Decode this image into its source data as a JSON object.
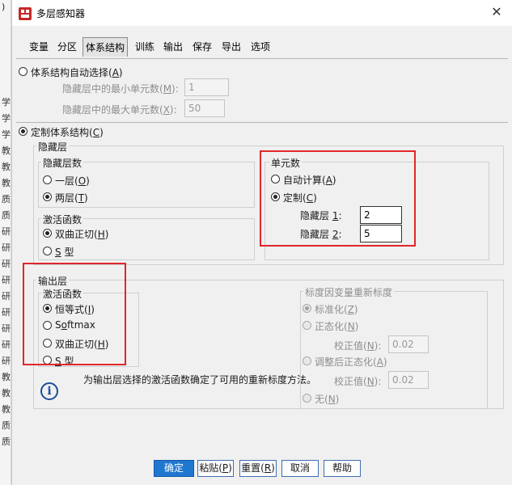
{
  "window": {
    "title": "多层感知器",
    "close_symbol": "✕"
  },
  "background_column": {
    "chars": [
      "学",
      "学",
      "学",
      "教",
      "教",
      "教",
      "质",
      "质",
      "研",
      "研",
      "研",
      "研",
      "研",
      "研",
      "研",
      "研",
      "研",
      "教",
      "教",
      "教",
      "质",
      "质"
    ]
  },
  "tabs": [
    "变量",
    "分区",
    "体系结构",
    "训练",
    "输出",
    "保存",
    "导出",
    "选项"
  ],
  "active_tab": "体系结构",
  "architecture": {
    "auto": {
      "label_pre": "体系结构自动选择(",
      "label_key": "A",
      "label_post": ")",
      "min_units": {
        "label_pre": "隐藏层中的最小单元数(",
        "label_key": "M",
        "label_post": "):",
        "value": "1"
      },
      "max_units": {
        "label_pre": "隐藏层中的最大单元数(",
        "label_key": "X",
        "label_post": "):",
        "value": "50"
      }
    },
    "custom": {
      "label_pre": "定制体系结构(",
      "label_key": "C",
      "label_post": ")"
    }
  },
  "hidden_layer": {
    "title": "隐藏层",
    "layer_count": {
      "title": "隐藏层数",
      "opt1": {
        "pre": "一层(",
        "key": "O",
        "post": ")"
      },
      "opt2": {
        "pre": "两层(",
        "key": "T",
        "post": ")"
      }
    },
    "activation": {
      "title": "激活函数",
      "opt1": {
        "pre": "双曲正切(",
        "key": "H",
        "post": ")"
      },
      "opt2": {
        "key": "S",
        "post": " 型"
      }
    },
    "units": {
      "title": "单元数",
      "auto": {
        "pre": "自动计算(",
        "key": "A",
        "post": ")"
      },
      "custom": {
        "pre": "定制(",
        "key": "C",
        "post": ")"
      },
      "layer1": {
        "pre": "隐藏层 ",
        "key": "1",
        "post": ":",
        "value": "2"
      },
      "layer2": {
        "pre": "隐藏层 ",
        "key": "2",
        "post": ":",
        "value": "5"
      }
    }
  },
  "output_layer": {
    "title": "输出层",
    "activation": {
      "title": "激活函数",
      "opt1": {
        "pre": "恒等式(",
        "key": "I",
        "post": ")"
      },
      "opt2": {
        "pre": "S",
        "key": "o",
        "post": "ftmax"
      },
      "opt3": {
        "pre": "双曲正切(",
        "key": "H",
        "post": ")"
      },
      "opt4": {
        "key": "S",
        "post": " 型"
      }
    },
    "rescale": {
      "title": "标度因变量重新标度",
      "std": {
        "pre": "标准化(",
        "key": "Z",
        "post": ")"
      },
      "norm": {
        "pre": "正态化(",
        "key": "N",
        "post": ")"
      },
      "corr1": {
        "pre": "校正值(",
        "key": "N",
        "post": "):",
        "value": "0.02"
      },
      "adj": {
        "pre": "调整后正态化(",
        "key": "A",
        "post": ")"
      },
      "corr2": {
        "pre": "校正值(",
        "key": "N",
        "post": "):",
        "value": "0.02"
      },
      "none": {
        "pre": "无(",
        "key": "N",
        "post": ")"
      }
    },
    "info_text": "为输出层选择的激活函数确定了可用的重新标度方法。"
  },
  "buttons": {
    "ok": "确定",
    "paste": {
      "pre": "粘贴(",
      "key": "P",
      "post": ")"
    },
    "reset": {
      "pre": "重置(",
      "key": "R",
      "post": ")"
    },
    "cancel": "取消",
    "help": "帮助"
  },
  "colors": {
    "highlight_box": "#e0262b",
    "primary_button": "#1f77d0",
    "info_icon": "#1b4e9b"
  }
}
